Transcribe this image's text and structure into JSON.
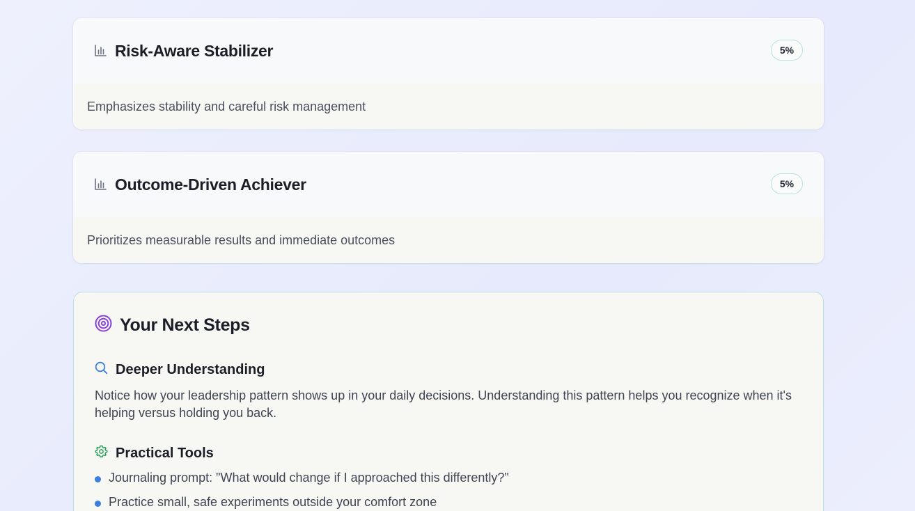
{
  "cards": [
    {
      "title": "Risk-Aware Stabilizer",
      "percent": "5%",
      "description": "Emphasizes stability and careful risk management",
      "icon": "bar-chart-icon"
    },
    {
      "title": "Outcome-Driven Achiever",
      "percent": "5%",
      "description": "Prioritizes measurable results and immediate outcomes",
      "icon": "bar-chart-icon"
    }
  ],
  "next_steps": {
    "title": "Your Next Steps",
    "icon": "target-icon",
    "accent_color": "#8b3fd9",
    "deeper": {
      "title": "Deeper Understanding",
      "icon": "search-icon",
      "icon_color": "#3b7de0",
      "text": "Notice how your leadership pattern shows up in your daily decisions. Understanding this pattern helps you recognize when it's helping versus holding you back."
    },
    "tools": {
      "title": "Practical Tools",
      "icon": "gear-icon",
      "icon_color": "#1f9d55",
      "items": [
        "Journaling prompt: \"What would change if I approached this differently?\"",
        "Practice small, safe experiments outside your comfort zone"
      ]
    }
  },
  "colors": {
    "badge_border": "#b7e0dc",
    "bullet": "#3b7de0",
    "steps_border": "#b9dfe0"
  }
}
